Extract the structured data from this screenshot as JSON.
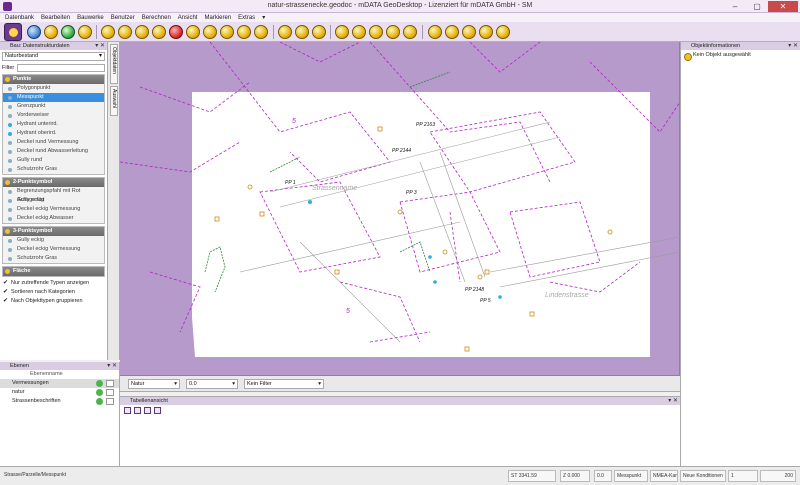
{
  "window": {
    "title": "natur-strassenecke.geodoc - mDATA GeoDesktop - Lizenziert für mDATA GmbH - SM",
    "buttons": [
      "–",
      "▢",
      "✕"
    ]
  },
  "menu": [
    "Datenbank",
    "Bearbeiten",
    "Bauwerke",
    "Benutzer",
    "Berechnen",
    "Ansicht",
    "Markieren",
    "Extras",
    "▾"
  ],
  "left_panel": {
    "title": "Bau: Datenstrukturdaten",
    "dropdown": "Naturbestand",
    "filter_label": "Filter",
    "groups": [
      {
        "title": "Punkte",
        "items": [
          {
            "label": "Polygonpunkt",
            "selected": false,
            "dot": "grey"
          },
          {
            "label": "Messpunkt",
            "selected": true,
            "dot": "grey"
          },
          {
            "label": "Grenzpunkt",
            "selected": false,
            "dot": "grey"
          },
          {
            "label": "Vorderweiser",
            "selected": false,
            "dot": "grey"
          },
          {
            "label": "Hydrant unterird.",
            "selected": false,
            "dot": "cyan"
          },
          {
            "label": "Hydrant oberird.",
            "selected": false,
            "dot": "cyan"
          },
          {
            "label": "Deckel rund Vermessung",
            "selected": false,
            "dot": "grey"
          },
          {
            "label": "Deckel rund Abwasserleitung",
            "selected": false,
            "dot": "grey"
          },
          {
            "label": "Gully rund",
            "selected": false,
            "dot": "grey"
          },
          {
            "label": "Schutzrohr Gras",
            "selected": false,
            "dot": "grey"
          }
        ]
      },
      {
        "title": "2-Punktsymbol",
        "items": [
          {
            "label": "Begrenzungspfahl mit Rot Achsgerüst",
            "selected": false,
            "dot": "grey"
          },
          {
            "label": "Gully eckig",
            "selected": false,
            "dot": "grey"
          },
          {
            "label": "Deckel eckig Vermessung",
            "selected": false,
            "dot": "grey"
          },
          {
            "label": "Deckel eckig Abwasser",
            "selected": false,
            "dot": "grey"
          }
        ]
      },
      {
        "title": "3-Punktsymbol",
        "items": [
          {
            "label": "Gully eckig",
            "selected": false,
            "dot": "grey"
          },
          {
            "label": "Deckel eckig Vermessung",
            "selected": false,
            "dot": "grey"
          },
          {
            "label": "Schutzrohr Gras",
            "selected": false,
            "dot": "grey"
          }
        ]
      },
      {
        "title": "Fläche",
        "items": []
      }
    ],
    "checks": [
      "Nur zutreffende Typen anzeigen",
      "Sortieren nach Kategorien",
      "Nach Objekttypen gruppieren"
    ]
  },
  "side_tabs": [
    "Objektdaten",
    "Auswahl"
  ],
  "layers_panel": {
    "title": "Ebenen",
    "column": "Ebenenname",
    "rows": [
      {
        "label": "Vermessungen",
        "selected": true
      },
      {
        "label": "natur",
        "selected": false
      },
      {
        "label": "Strassenbeschriften",
        "selected": false
      }
    ]
  },
  "map": {
    "street_labels": [
      "Strassenname",
      "Lindenstrasse"
    ],
    "points": [
      "PP 2163",
      "PP 2144",
      "PP 1",
      "PP 3",
      "PP 2148",
      "PP 5"
    ],
    "parcels": [
      "5",
      "5"
    ]
  },
  "map_bar": {
    "layer_select": "Natur",
    "value_select": "0.0",
    "filter_select": "Kein Filter"
  },
  "table_panel": {
    "title": "Tabellenansicht"
  },
  "right_panel": {
    "title": "Objektinformationen",
    "info": "Kein Objekt ausgewählt"
  },
  "status": {
    "left": "Strasse/Parzelle/Messpunkt",
    "segments": [
      "ST 3341.59",
      "Z 0.000",
      "0.0",
      "Messpunkt",
      "NMEA-Kanal",
      "Neue Konditionen",
      "1",
      "200"
    ]
  }
}
